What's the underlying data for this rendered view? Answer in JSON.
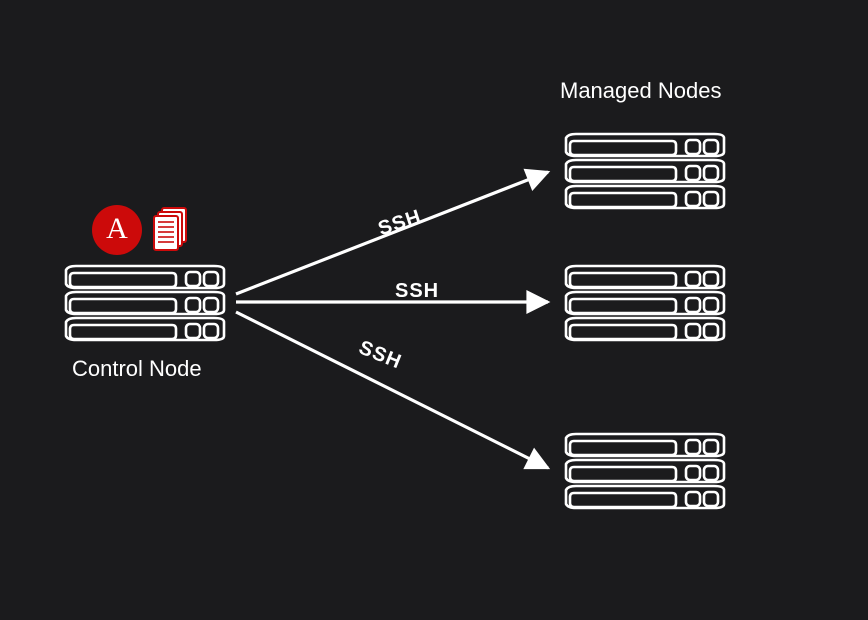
{
  "diagram": {
    "title_managed": "Managed Nodes",
    "title_control": "Control Node",
    "connection_label_1": "SSH",
    "connection_label_2": "SSH",
    "connection_label_3": "SSH",
    "ansible_glyph": "A"
  },
  "chart_data": {
    "type": "diagram",
    "description": "Ansible architecture: one Control Node connects over SSH to three Managed Nodes.",
    "nodes": [
      {
        "id": "control",
        "label": "Control Node",
        "role": "control",
        "badges": [
          "ansible-logo",
          "playbook-file"
        ]
      },
      {
        "id": "managed-1",
        "label": "Managed Node",
        "role": "managed"
      },
      {
        "id": "managed-2",
        "label": "Managed Node",
        "role": "managed"
      },
      {
        "id": "managed-3",
        "label": "Managed Node",
        "role": "managed"
      }
    ],
    "edges": [
      {
        "from": "control",
        "to": "managed-1",
        "label": "SSH",
        "protocol": "SSH"
      },
      {
        "from": "control",
        "to": "managed-2",
        "label": "SSH",
        "protocol": "SSH"
      },
      {
        "from": "control",
        "to": "managed-3",
        "label": "SSH",
        "protocol": "SSH"
      }
    ],
    "colors": {
      "background": "#1b1b1d",
      "stroke": "#ffffff",
      "accent": "#cc0a0a"
    }
  }
}
